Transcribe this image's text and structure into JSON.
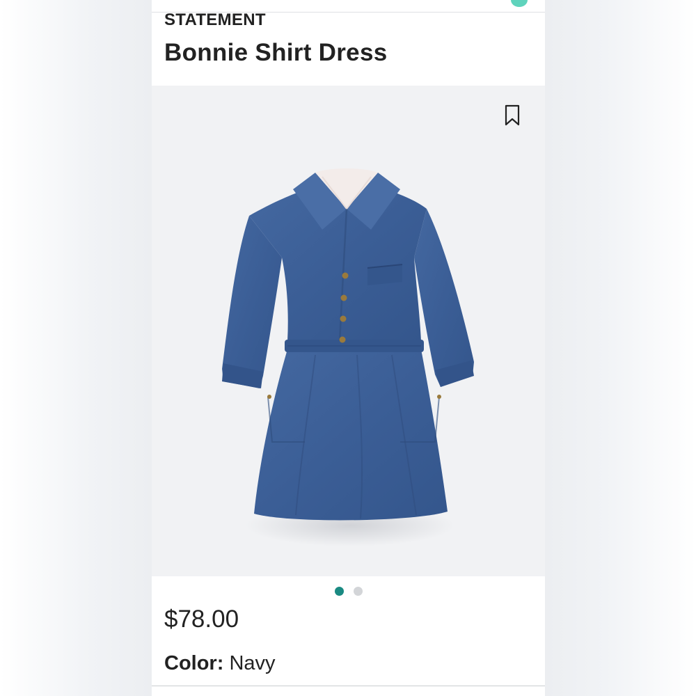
{
  "product": {
    "brand": "STATEMENT",
    "name": "Bonnie Shirt Dress",
    "price": "$78.00",
    "color_label": "Color:",
    "color_value": "Navy"
  },
  "gallery": {
    "image_name": "navy-shirt-dress",
    "slide_count": 2,
    "active_slide": 1,
    "active_dot_color": "#1a8a82",
    "inactive_dot_color": "#d3d5d8"
  },
  "icons": {
    "bookmark": "bookmark-icon"
  },
  "colors": {
    "dress_primary": "#3b5e96",
    "dress_shadow": "#2f4c7d",
    "background": "#f1f2f4",
    "text": "#222222"
  }
}
